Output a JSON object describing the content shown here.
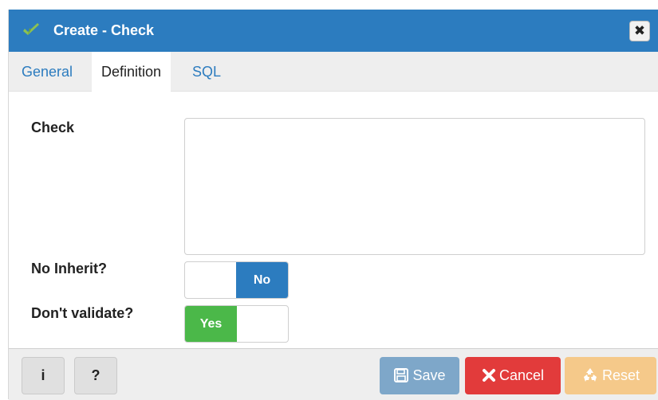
{
  "dialog": {
    "title": "Create - Check",
    "close_label": "✖"
  },
  "tabs": [
    {
      "label": "General",
      "active": false
    },
    {
      "label": "Definition",
      "active": true
    },
    {
      "label": "SQL",
      "active": false
    }
  ],
  "form": {
    "check_label": "Check",
    "check_value": "",
    "no_inherit_label": "No Inherit?",
    "no_inherit_state": "No",
    "dont_validate_label": "Don't validate?",
    "dont_validate_state": "Yes"
  },
  "footer": {
    "info_label": "i",
    "help_label": "?",
    "save_label": "Save",
    "cancel_label": "Cancel",
    "reset_label": "Reset"
  },
  "colors": {
    "titlebar": "#2c7cbf",
    "toggle_no": "#2c7cbf",
    "toggle_yes": "#4bb849",
    "save": "#7ea7c9",
    "cancel": "#e23b3b",
    "reset": "#f5c98a"
  },
  "icons": {
    "title": "check-leaf-icon",
    "save": "floppy-disk-icon",
    "cancel": "x-icon",
    "reset": "recycle-icon"
  }
}
